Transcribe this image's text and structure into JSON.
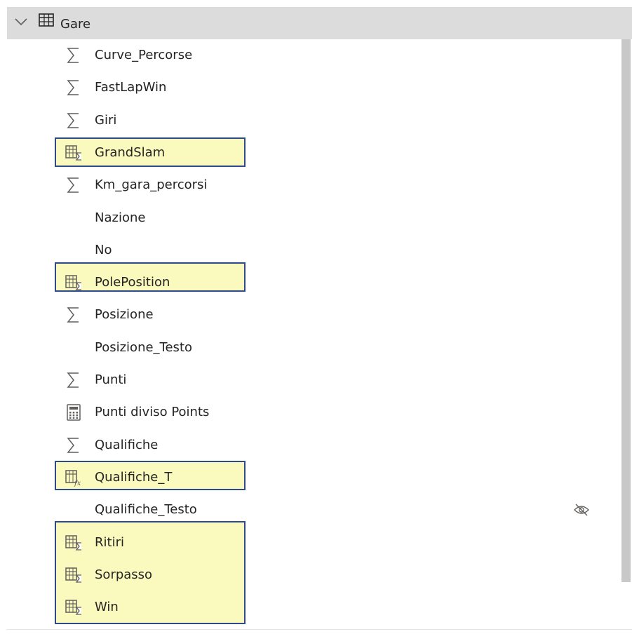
{
  "table": {
    "name": "Gare",
    "expand_icon": "chevron-down-icon",
    "table_icon": "table-icon"
  },
  "fields": [
    {
      "label": "Curve_Percorse",
      "icon": "sigma-icon"
    },
    {
      "label": "FastLapWin",
      "icon": "sigma-icon"
    },
    {
      "label": "Giri",
      "icon": "sigma-icon"
    },
    {
      "label": "GrandSlam",
      "icon": "measure-table-icon"
    },
    {
      "label": "Km_gara_percorsi",
      "icon": "sigma-icon"
    },
    {
      "label": "Nazione",
      "icon": ""
    },
    {
      "label": "No",
      "icon": ""
    },
    {
      "label": "PolePosition",
      "icon": "measure-table-icon"
    },
    {
      "label": "Posizione",
      "icon": "sigma-icon"
    },
    {
      "label": "Posizione_Testo",
      "icon": ""
    },
    {
      "label": "Punti",
      "icon": "sigma-icon"
    },
    {
      "label": "Punti diviso Points",
      "icon": "calculator-icon"
    },
    {
      "label": "Qualifiche",
      "icon": "sigma-icon"
    },
    {
      "label": "Qualifiche_T",
      "icon": "measure-fx-icon"
    },
    {
      "label": "Qualifiche_Testo",
      "icon": "",
      "hidden_icon": "eye-hidden-icon"
    },
    {
      "label": "Ritiri",
      "icon": "measure-table-icon"
    },
    {
      "label": "Sorpasso",
      "icon": "measure-table-icon"
    },
    {
      "label": "Win",
      "icon": "measure-table-icon"
    }
  ],
  "colors": {
    "header_bg": "#dcdcdc",
    "highlight_fill": "#fafabf",
    "highlight_border": "#2f4a8a",
    "text": "#252423",
    "icon": "#605e5c",
    "scrollbar": "#c8c8c8"
  }
}
